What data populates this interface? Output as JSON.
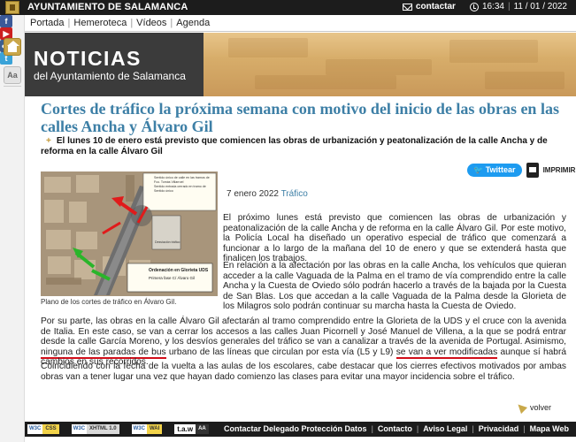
{
  "header": {
    "site_title": "AYUNTAMIENTO DE SALAMANCA",
    "contact_label": "contactar",
    "time": "16:34",
    "date": "11 / 01 / 2022"
  },
  "nav": {
    "items": [
      "Portada",
      "Hemeroteca",
      "Vídeos",
      "Agenda"
    ]
  },
  "side": {
    "text_size_label": "Aa",
    "social": [
      "f",
      "▶",
      "●●",
      "t"
    ]
  },
  "banner": {
    "title": "NOTICIAS",
    "subtitle": "del Ayuntamiento de Salamanca"
  },
  "article": {
    "headline": "Cortes de tráfico la próxima semana con motivo del inicio de las obras en las calles Ancha y Álvaro Gil",
    "lead": "El lunes 10 de enero está previsto que comiencen las obras de urbanización y peatonalización de la calle Ancha y de reforma en la calle Álvaro Gil",
    "tweet_label": "Twittear",
    "print_label": "IMPRIMIR",
    "caption": "Plano de los cortes de tráfico en Álvaro Gil.",
    "date": "7 enero 2022",
    "category": "Tráfico",
    "p1": "El próximo lunes está previsto que comiencen las obras de urbanización y peatonalización de la calle Ancha y de reforma en la calle Álvaro Gil. Por este motivo, la Policía Local ha diseñado un operativo especial de tráfico que comenzará a funcionar a lo largo de la mañana del 10 de enero y que se extenderá hasta que finalicen los trabajos.",
    "p2": "En relación a la afectación por las obras en la calle Ancha, los vehículos que quieran acceder a la calle Vaguada de la Palma en el tramo de vía comprendido entre la calle Ancha y la Cuesta de Oviedo sólo podrán hacerlo a través de la bajada por la Cuesta de San Blas. Los que accedan a la calle Vaguada de la Palma desde la Glorieta de los Milagros solo podrán continuar su marcha hasta la Cuesta de Oviedo.",
    "p3_a": "Por su parte, las obras en la calle Álvaro Gil afectarán al tramo comprendido entre la Glorieta de la UDS y el cruce con la avenida de Italia. En este caso, se van a cerrar los accesos a las calles Juan Picornell y José Manuel de Villena, a la que se podrá entrar desde la calle García Moreno, y los desvíos generales del tráfico se van a canalizar a través de la avenida de Portugal. Asimismo, ",
    "p3_u1": "ninguna de las paradas de bus",
    "p3_b": " urbano de las líneas que circulan por esta vía (L5 y L9) ",
    "p3_u2": "se van a ver modificadas",
    "p3_c": " aunque sí habrá cambios en sus recorridos.",
    "p4": "Coincidiendo con la fecha de la vuelta a las aulas de los escolares, cabe destacar que los cierres efectivos motivados por ambas obras van a tener lugar una vez que hayan dado comienzo las clases para evitar una mayor incidencia sobre el tráfico.",
    "back_label": "volver"
  },
  "map": {
    "legend": [
      "Sentido único de calle en las tramos de",
      "Fco. Tomás Villarroel",
      "Sentido entrada cerrado en tramo de",
      "Sentido único",
      "Desviación tráfico"
    ],
    "box_title": "Ordenación en Glorieta UDS",
    "box_subtitle": "Primera fase C/ Álvaro Gil"
  },
  "footer": {
    "badges": [
      {
        "a": "W3C",
        "b": "CSS"
      },
      {
        "a": "W3C",
        "b": "XHTML 1.0"
      },
      {
        "a": "W3C",
        "b": "WAI"
      },
      {
        "a": "t.a.w",
        "b": "AA"
      }
    ],
    "links": [
      "Contactar Delegado Protección Datos",
      "Contacto",
      "Aviso Legal",
      "Privacidad",
      "Mapa Web"
    ]
  },
  "colors": {
    "accent": "#3d7fa6",
    "gold": "#c9a94a",
    "underline": "#d10f1a"
  }
}
